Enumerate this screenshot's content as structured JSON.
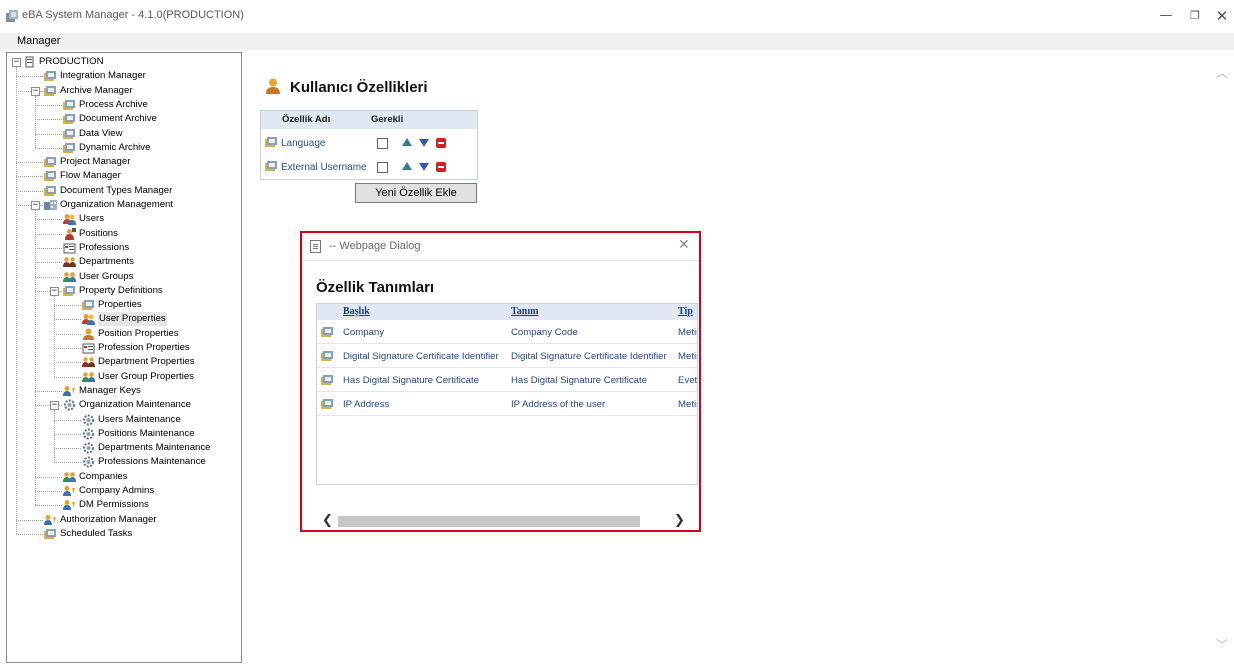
{
  "window": {
    "title": "eBA System Manager - 4.1.0(PRODUCTION)",
    "min_glyph": "—",
    "max_glyph": "❐",
    "close_glyph": "✕"
  },
  "menu": {
    "items": [
      "Manager"
    ]
  },
  "tree": {
    "nodes": [
      {
        "label": "PRODUCTION",
        "icon": "database-icon"
      },
      {
        "label": "Integration Manager",
        "icon": "folder-tool-icon"
      },
      {
        "label": "Archive Manager",
        "icon": "folder-tool-icon"
      },
      {
        "label": "Process Archive",
        "icon": "folder-tool-icon"
      },
      {
        "label": "Document Archive",
        "icon": "folder-tool-icon"
      },
      {
        "label": "Data View",
        "icon": "folder-tool-icon"
      },
      {
        "label": "Dynamic Archive",
        "icon": "folder-tool-icon"
      },
      {
        "label": "Project Manager",
        "icon": "folder-tool-icon"
      },
      {
        "label": "Flow Manager",
        "icon": "folder-tool-icon"
      },
      {
        "label": "Document Types Manager",
        "icon": "folder-tool-icon"
      },
      {
        "label": "Organization Management",
        "icon": "organization-icon"
      },
      {
        "label": "Users",
        "icon": "users-icon"
      },
      {
        "label": "Positions",
        "icon": "positions-icon"
      },
      {
        "label": "Professions",
        "icon": "professions-icon"
      },
      {
        "label": "Departments",
        "icon": "departments-icon"
      },
      {
        "label": "User Groups",
        "icon": "user-groups-icon"
      },
      {
        "label": "Property Definitions",
        "icon": "folder-tool-icon"
      },
      {
        "label": "Properties",
        "icon": "folder-tool-icon"
      },
      {
        "label": "User Properties",
        "icon": "users-icon"
      },
      {
        "label": "Position Properties",
        "icon": "user-icon"
      },
      {
        "label": "Profession Properties",
        "icon": "professions-icon"
      },
      {
        "label": "Department Properties",
        "icon": "departments-icon"
      },
      {
        "label": "User Group Properties",
        "icon": "user-groups-icon"
      },
      {
        "label": "Manager Keys",
        "icon": "key-user-icon"
      },
      {
        "label": "Organization Maintenance",
        "icon": "gear-icon"
      },
      {
        "label": "Users Maintenance",
        "icon": "gear-icon"
      },
      {
        "label": "Positions Maintenance",
        "icon": "gear-icon"
      },
      {
        "label": "Departments Maintenance",
        "icon": "gear-icon"
      },
      {
        "label": "Professions Maintenance",
        "icon": "gear-icon"
      },
      {
        "label": "Companies",
        "icon": "user-groups-icon"
      },
      {
        "label": "Company Admins",
        "icon": "key-user-icon"
      },
      {
        "label": "DM Permissions",
        "icon": "key-user-icon"
      },
      {
        "label": "Authorization Manager",
        "icon": "key-user-icon"
      },
      {
        "label": "Scheduled Tasks",
        "icon": "folder-tool-icon"
      }
    ],
    "expander_minus": "−"
  },
  "user_props": {
    "title": "Kullanıcı Özellikleri",
    "col_name": "Özellik Adı",
    "col_required": "Gerekli",
    "rows": [
      {
        "name": "Language"
      },
      {
        "name": "External Username"
      }
    ],
    "add_button": "Yeni Özellik Ekle"
  },
  "dialog": {
    "title": "-- Webpage Dialog",
    "close_glyph": "✕",
    "heading": "Özellik Tanımları",
    "columns": [
      "Başlık",
      "Tanım",
      "Tip"
    ],
    "rows": [
      {
        "title": "Company",
        "desc": "Company Code",
        "type": "Metin"
      },
      {
        "title": "Digital Signature Certificate Identifier",
        "desc": "Digital Signature Certificate Identifier",
        "type": "Metin"
      },
      {
        "title": "Has Digital Signature Certificate",
        "desc": "Has Digital Signature Certificate",
        "type": "Evet"
      },
      {
        "title": "IP Address",
        "desc": "IP Address of the user",
        "type": "Metin"
      }
    ],
    "scroll_left": "❮",
    "scroll_right": "❯"
  },
  "scroll": {
    "up": "︿",
    "down": "﹀"
  },
  "colors": {
    "dialog_border": "#d4001a",
    "header_bg": "#dfe8f3",
    "link_text": "#27497d"
  }
}
